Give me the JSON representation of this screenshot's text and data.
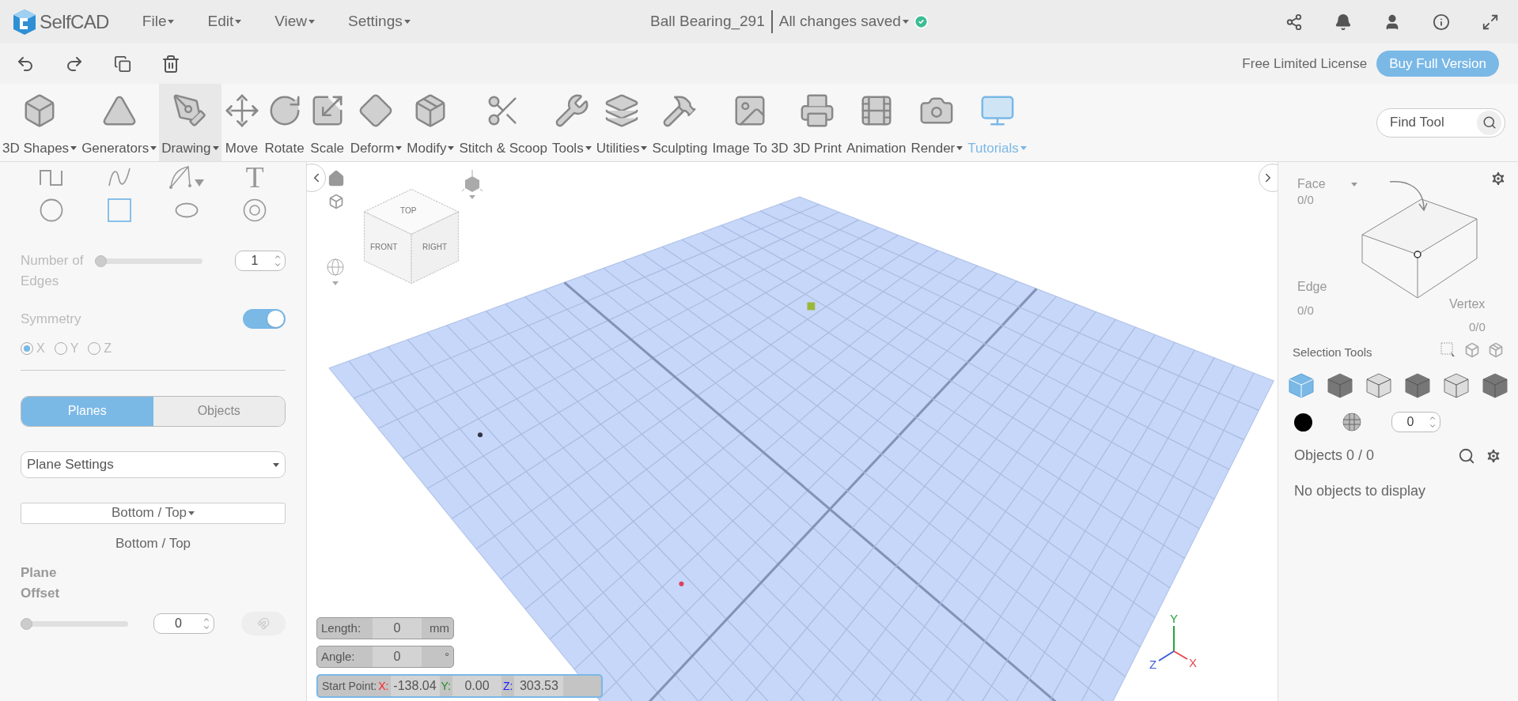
{
  "app": {
    "name": "SelfCAD"
  },
  "menu": [
    {
      "label": "File"
    },
    {
      "label": "Edit"
    },
    {
      "label": "View"
    },
    {
      "label": "Settings"
    }
  ],
  "document": {
    "title": "Ball Bearing_291",
    "status": "All changes saved",
    "saved": true
  },
  "license": {
    "label": "Free Limited License",
    "button": "Buy Full Version"
  },
  "toolbar": [
    {
      "label": "3D Shapes",
      "dropdown": true,
      "selected": false,
      "kind": "tool"
    },
    {
      "label": "Generators",
      "dropdown": true,
      "selected": false,
      "kind": "tool"
    },
    {
      "label": "Drawing",
      "dropdown": true,
      "selected": true,
      "kind": "tool"
    },
    {
      "label": "Move",
      "dropdown": false,
      "selected": false,
      "kind": "tool"
    },
    {
      "label": "Rotate",
      "dropdown": false,
      "selected": false,
      "kind": "tool"
    },
    {
      "label": "Scale",
      "dropdown": false,
      "selected": false,
      "kind": "tool"
    },
    {
      "label": "Deform",
      "dropdown": true,
      "selected": false,
      "kind": "tool"
    },
    {
      "label": "Modify",
      "dropdown": true,
      "selected": false,
      "kind": "tool"
    },
    {
      "label": "Stitch & Scoop",
      "dropdown": false,
      "selected": false,
      "kind": "tool"
    },
    {
      "label": "Tools",
      "dropdown": true,
      "selected": false,
      "kind": "tool"
    },
    {
      "label": "Utilities",
      "dropdown": true,
      "selected": false,
      "kind": "tool"
    },
    {
      "label": "Sculpting",
      "dropdown": false,
      "selected": false,
      "kind": "tool"
    },
    {
      "label": "Image To 3D",
      "dropdown": false,
      "selected": false,
      "kind": "tool"
    },
    {
      "label": "3D Print",
      "dropdown": false,
      "selected": false,
      "kind": "tool"
    },
    {
      "label": "Animation",
      "dropdown": false,
      "selected": false,
      "kind": "tool"
    },
    {
      "label": "Render",
      "dropdown": true,
      "selected": false,
      "kind": "tool"
    },
    {
      "label": "Tutorials",
      "dropdown": true,
      "selected": false,
      "kind": "link"
    }
  ],
  "find_tool": {
    "placeholder": "Find Tool"
  },
  "left_panel": {
    "shapes": [
      {
        "kind": "polyline",
        "selected": false
      },
      {
        "kind": "curve",
        "selected": false
      },
      {
        "kind": "bezier",
        "selected": false
      },
      {
        "kind": "text",
        "glyph": "T",
        "selected": false
      },
      {
        "kind": "circle",
        "selected": false
      },
      {
        "kind": "square",
        "selected": true
      },
      {
        "kind": "ellipse",
        "selected": false
      },
      {
        "kind": "ring",
        "selected": false
      }
    ],
    "edges": {
      "label": "Number of Edges",
      "level": 0,
      "value": "1"
    },
    "symmetry": {
      "label": "Symmetry",
      "on": true,
      "axes": [
        {
          "label": "X",
          "selected": true
        },
        {
          "label": "Y",
          "selected": false
        },
        {
          "label": "Z",
          "selected": false
        }
      ]
    },
    "tabs": [
      {
        "label": "Planes",
        "selected": true
      },
      {
        "label": "Objects",
        "selected": false
      }
    ],
    "plane_settings": "Plane Settings",
    "plane_button": "Bottom / Top",
    "plane_label": "Bottom / Top",
    "offset": {
      "label": "Plane Offset",
      "level": 0,
      "value": "0",
      "magnet_disabled": true
    }
  },
  "viewport": {
    "cube_faces": [
      "TOP",
      "FRONT",
      "RIGHT"
    ],
    "axes": [
      {
        "label": "Y",
        "color": "#22a33a"
      },
      {
        "label": "Z",
        "color": "#3b5bdb"
      },
      {
        "label": "X",
        "color": "#e5484d"
      }
    ],
    "length": {
      "label": "Length:",
      "value": "0",
      "unit": "mm"
    },
    "angle": {
      "label": "Angle:",
      "value": "0",
      "unit": "°"
    },
    "start_point": {
      "label": "Start Point:",
      "coords": [
        {
          "axis": "X:",
          "value": "-138.04",
          "color": "#ff2020"
        },
        {
          "axis": "Y:",
          "value": "0.00",
          "color": "#1f8a1f"
        },
        {
          "axis": "Z:",
          "value": "303.53",
          "color": "#2020ff"
        }
      ]
    }
  },
  "right_panel": {
    "face": {
      "label": "Face",
      "count": "0/0"
    },
    "edge": {
      "label": "Edge",
      "count": "0/0"
    },
    "vertex": {
      "label": "Vertex",
      "count": "0/0"
    },
    "selection_tools": "Selection Tools",
    "modes": [
      {
        "selected": true
      },
      {
        "selected": false
      },
      {
        "selected": false
      },
      {
        "selected": false
      },
      {
        "selected": false
      },
      {
        "selected": false
      }
    ],
    "color": "#000000",
    "spinner": "0",
    "objects": "Objects 0 / 0",
    "empty": "No objects to display"
  }
}
